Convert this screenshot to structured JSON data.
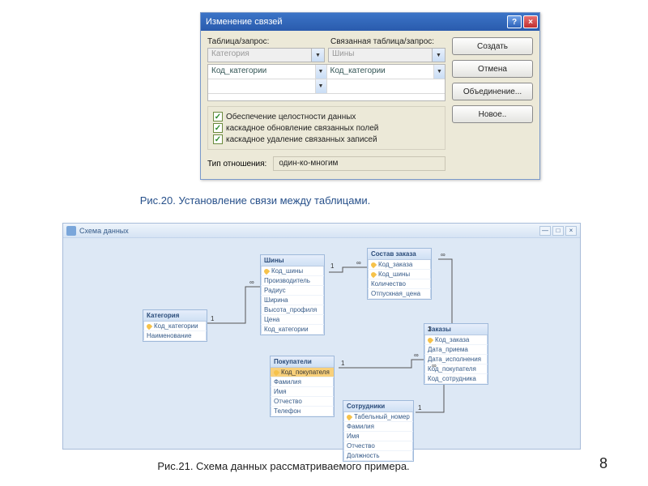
{
  "dialog": {
    "title": "Изменение связей",
    "left_label": "Таблица/запрос:",
    "right_label": "Связанная таблица/запрос:",
    "combo_left": "Категория",
    "combo_right": "Шины",
    "grid_left": "Код_категории",
    "grid_right": "Код_категории",
    "chk1": "Обеспечение целостности данных",
    "chk2": "каскадное обновление связанных полей",
    "chk3": "каскадное удаление связанных записей",
    "reltype_label": "Тип отношения:",
    "reltype_value": "один-ко-многим",
    "buttons": {
      "create": "Создать",
      "cancel": "Отмена",
      "join": "Объединение...",
      "new": "Новое.."
    }
  },
  "caption1": "Рис.20. Установление связи между таблицами.",
  "caption2": "Рис.21. Схема данных рассматриваемого примера.",
  "page_number": "8",
  "schema": {
    "title": "Схема данных",
    "tables": {
      "kategoria": {
        "name": "Категория",
        "fields": [
          "Код_категории",
          "Наименование"
        ],
        "pk": [
          0
        ]
      },
      "shiny": {
        "name": "Шины",
        "fields": [
          "Код_шины",
          "Производитель",
          "Радиус",
          "Ширина",
          "Высота_профиля",
          "Цена",
          "Код_категории"
        ],
        "pk": [
          0
        ]
      },
      "sostav": {
        "name": "Состав заказа",
        "fields": [
          "Код_заказа",
          "Код_шины",
          "Количество",
          "Отпускная_цена"
        ],
        "pk": [
          0,
          1
        ]
      },
      "pokupateli": {
        "name": "Покупатели",
        "fields": [
          "Код_покупателя",
          "Фамилия",
          "Имя",
          "Отчество",
          "Телефон"
        ],
        "pk": [
          0
        ],
        "highlight": 0
      },
      "sotrudniki": {
        "name": "Сотрудники",
        "fields": [
          "Табельный_номер",
          "Фамилия",
          "Имя",
          "Отчество",
          "Должность"
        ],
        "pk": [
          0
        ]
      },
      "zakazy": {
        "name": "Заказы",
        "fields": [
          "Код_заказа",
          "Дата_приема",
          "Дата_исполнения",
          "Код_покупателя",
          "Код_сотрудника"
        ],
        "pk": [
          0
        ]
      }
    },
    "rel_labels": {
      "one": "1",
      "many": "∞"
    }
  }
}
